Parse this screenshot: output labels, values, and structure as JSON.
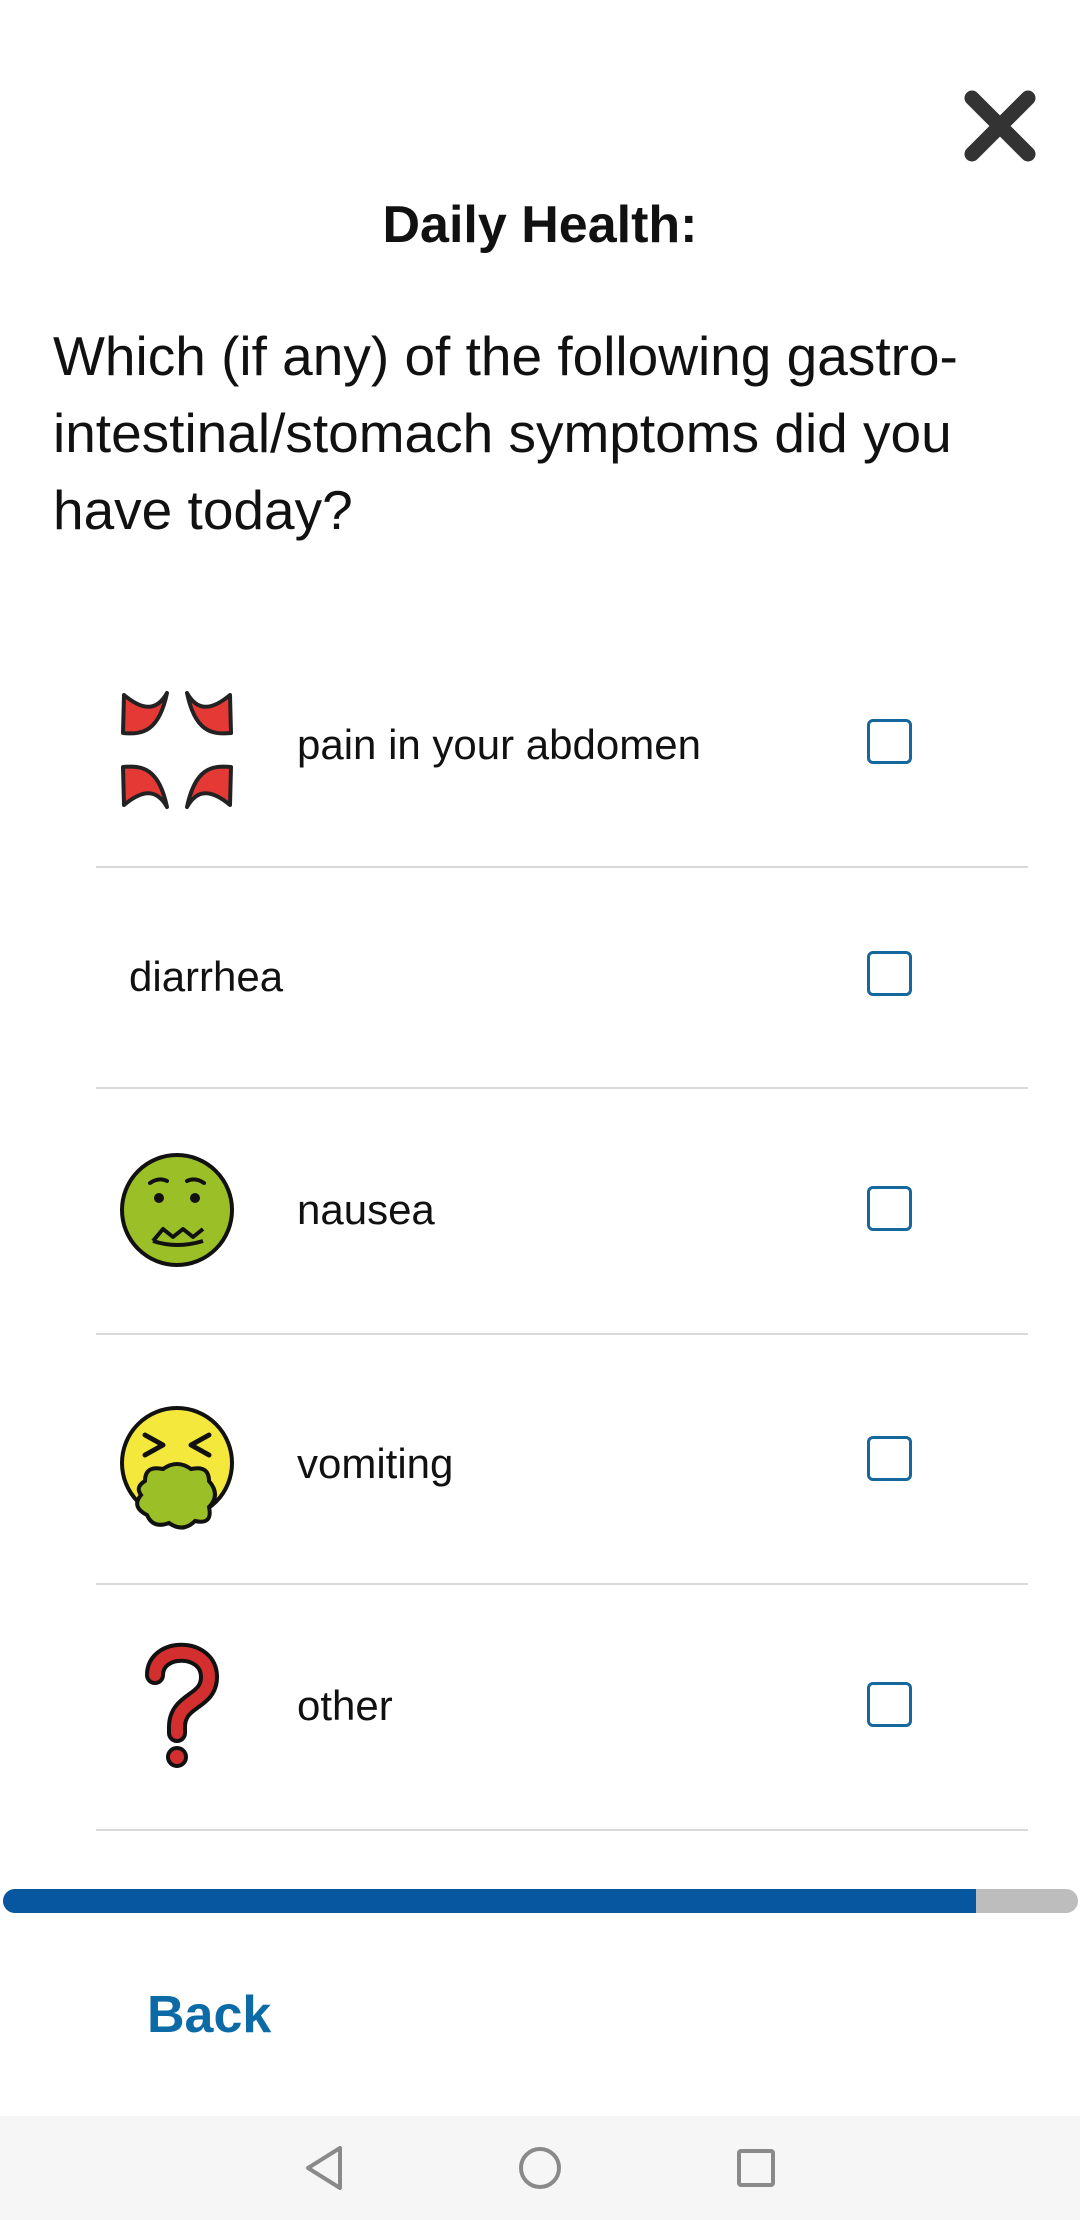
{
  "header": {
    "title": "Daily Health:",
    "close_icon": "close-x-icon"
  },
  "question": {
    "text": "Which (if any) of the following gastro-intestinal/stomach symptoms did you have today?"
  },
  "options": [
    {
      "label": "pain in your abdomen",
      "icon": "anger-symbol-icon",
      "checked": false
    },
    {
      "label": "diarrhea",
      "icon": "",
      "checked": false
    },
    {
      "label": "nausea",
      "icon": "nauseated-face-icon",
      "checked": false
    },
    {
      "label": "vomiting",
      "icon": "vomiting-face-icon",
      "checked": false
    },
    {
      "label": "other",
      "icon": "question-mark-icon",
      "checked": false
    }
  ],
  "progress": {
    "fraction": 0.905
  },
  "footer": {
    "back_label": "Back"
  },
  "nav_bar": {
    "buttons": [
      "back-triangle-icon",
      "home-circle-icon",
      "recents-square-icon"
    ]
  },
  "colors": {
    "accent": "#16679b",
    "progress_fill": "#0756a0",
    "progress_track": "#bdbdbd",
    "back_link": "#0c6ba6"
  }
}
